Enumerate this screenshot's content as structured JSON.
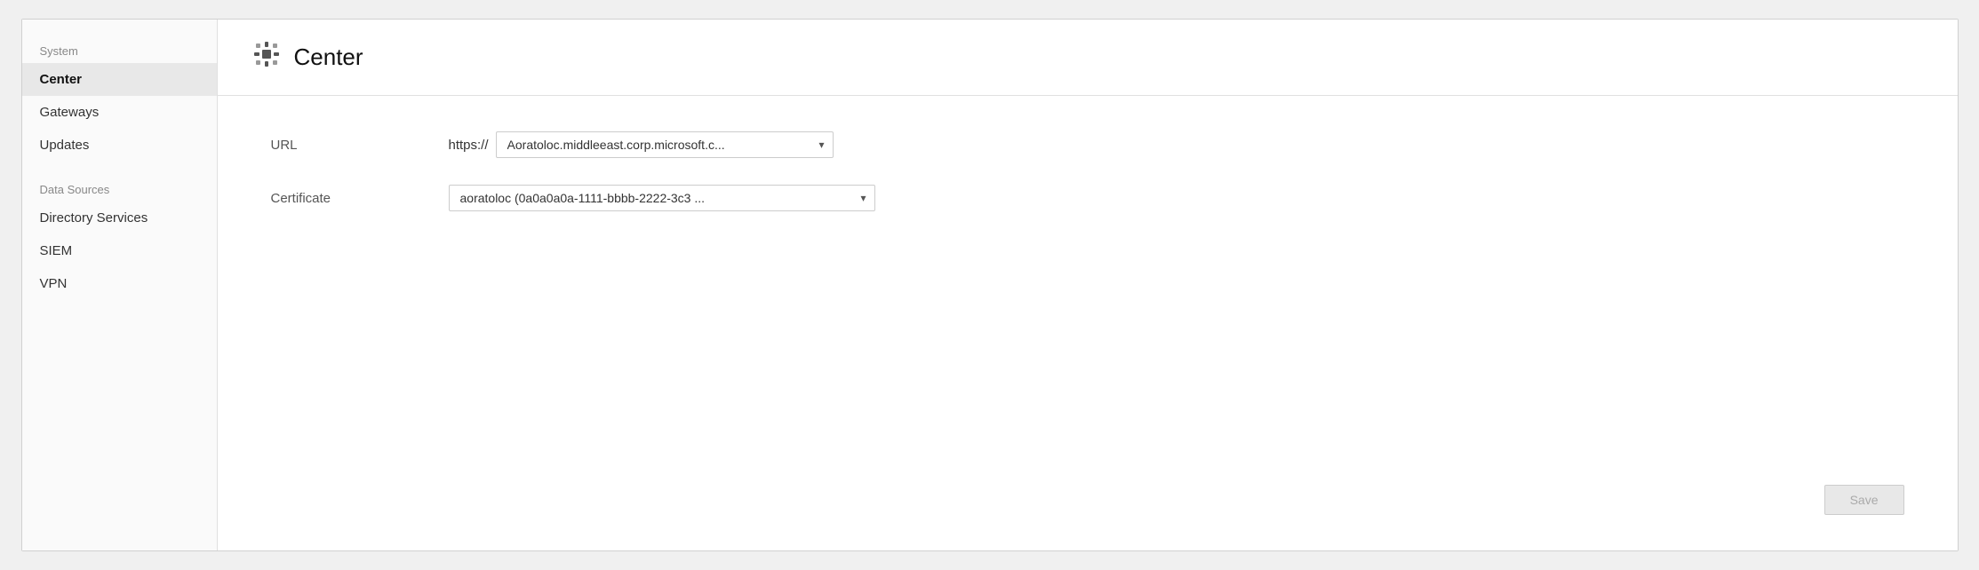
{
  "sidebar": {
    "system_label": "System",
    "data_sources_label": "Data Sources",
    "items": {
      "center": "Center",
      "gateways": "Gateways",
      "updates": "Updates",
      "directory_services": "Directory Services",
      "siem": "SIEM",
      "vpn": "VPN"
    }
  },
  "header": {
    "title": "Center",
    "icon": "⊞"
  },
  "form": {
    "url_label": "URL",
    "url_prefix": "https://",
    "url_value": "Aoratoloc.middleeast.corp.microsoft.c...",
    "certificate_label": "Certificate",
    "certificate_value": "aoratoloc (0a0a0a0a-1111-bbbb-2222-3c3 ..."
  },
  "toolbar": {
    "save_label": "Save"
  }
}
